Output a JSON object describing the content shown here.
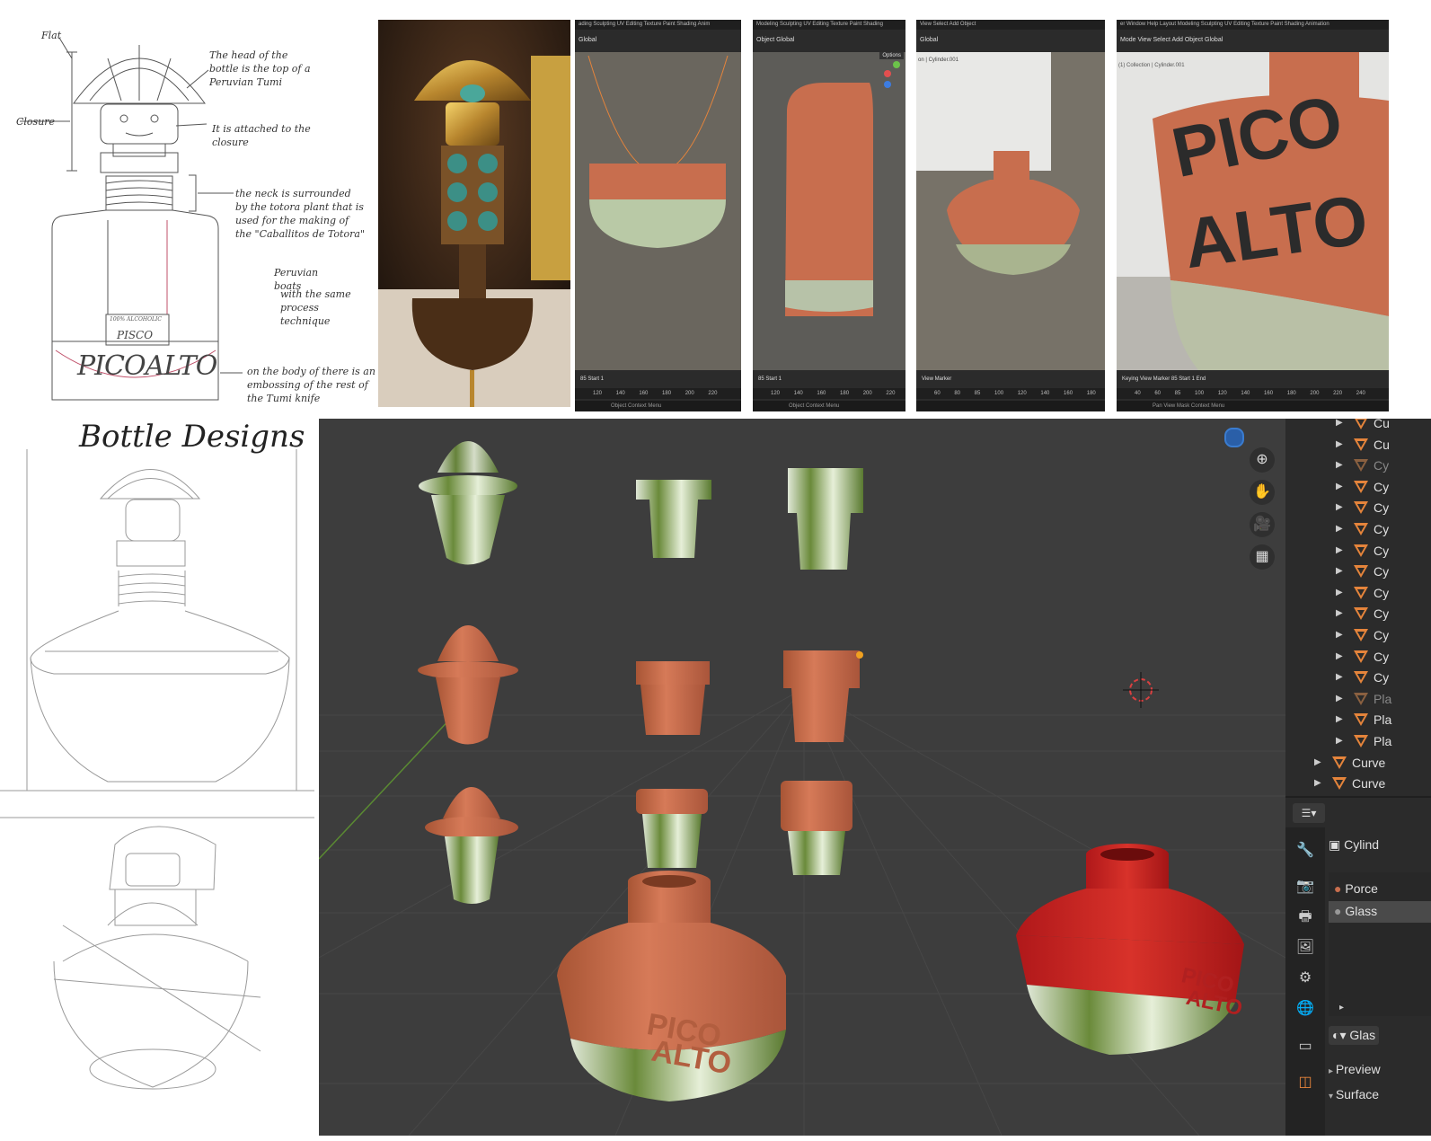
{
  "sketch_notes": {
    "flat": "Flat",
    "closure": "Closure",
    "head": "The head of the bottle is the top of a Peruvian Tumi",
    "attached": "It is attached to the closure",
    "neck": "the neck is surrounded by the totora plant that is used for the making of the \"Caballitos de Totora\"",
    "peruvian_boats": "Peruvian boats",
    "same_process": "with the same process technique",
    "body": "on the body of there is an embossing of the rest of the Tumi knife",
    "label_small": "PISCO",
    "label_big": "PICOALTO",
    "label_tiny": "100% ALCOHOLIC"
  },
  "title": "Bottle Designs",
  "render_text": {
    "line1": "PICO",
    "line2": "ALTO"
  },
  "shots": [
    {
      "menu": "ading  Sculpting  UV Editing  Texture Paint  Shading  Anim",
      "tool": "Global",
      "timeline": "85        Start    1",
      "nums": "120 140 160 180 200 220",
      "status": "Object Context Menu"
    },
    {
      "menu": "Modeling  Sculpting  UV Editing  Texture Paint  Shading",
      "tool": "Object   Global",
      "options": "Options",
      "timeline": "85        Start    1",
      "nums": "120 140 160 180 200 220 240",
      "status": "Object Context Menu"
    },
    {
      "menu": "View  Select  Add  Object",
      "tool": "Global",
      "obj": "on | Cylinder.001",
      "timeline": "View  Marker",
      "nums": "60 80 85 100 120 140 160 180",
      "status": ""
    },
    {
      "menu": "er  Window  Help   Layout  Modeling  Sculpting  UV Editing  Texture Paint  Shading  Animation",
      "tool": "Mode  View  Select  Add  Object   Global",
      "obj": "(1) Collection | Cylinder.001",
      "timeline": "Keying  View  Marker   85   Start 1  End",
      "nums": "40 60 85 100 120 140 160 180 200 220 240",
      "status": "Pan View        Mask Context Menu"
    }
  ],
  "outliner": [
    {
      "label": "Cu",
      "dim": false,
      "indent": 2
    },
    {
      "label": "Cu",
      "dim": false,
      "indent": 2
    },
    {
      "label": "Cy",
      "dim": true,
      "indent": 2
    },
    {
      "label": "Cy",
      "dim": false,
      "indent": 2
    },
    {
      "label": "Cy",
      "dim": false,
      "indent": 2
    },
    {
      "label": "Cy",
      "dim": false,
      "indent": 2
    },
    {
      "label": "Cy",
      "dim": false,
      "indent": 2
    },
    {
      "label": "Cy",
      "dim": false,
      "indent": 2
    },
    {
      "label": "Cy",
      "dim": false,
      "indent": 2
    },
    {
      "label": "Cy",
      "dim": false,
      "indent": 2
    },
    {
      "label": "Cy",
      "dim": false,
      "indent": 2
    },
    {
      "label": "Cy",
      "dim": false,
      "indent": 2
    },
    {
      "label": "Cy",
      "dim": false,
      "indent": 2
    },
    {
      "label": "Pla",
      "dim": true,
      "indent": 2
    },
    {
      "label": "Pla",
      "dim": false,
      "indent": 2
    },
    {
      "label": "Pla",
      "dim": false,
      "indent": 2
    },
    {
      "label": "Curve",
      "dim": false,
      "indent": 1
    },
    {
      "label": "Curve",
      "dim": false,
      "indent": 1
    }
  ],
  "properties": {
    "object_name": "Cylind",
    "materials": [
      "Porce",
      "Glass"
    ],
    "material_selector": "Glas",
    "preview": "Preview",
    "surface": "Surface"
  },
  "colors": {
    "terracotta": "#c86e4e",
    "red": "#c8261e",
    "panel": "#2b2b2b",
    "viewport": "#3d3d3d",
    "accent": "#e5843b"
  }
}
